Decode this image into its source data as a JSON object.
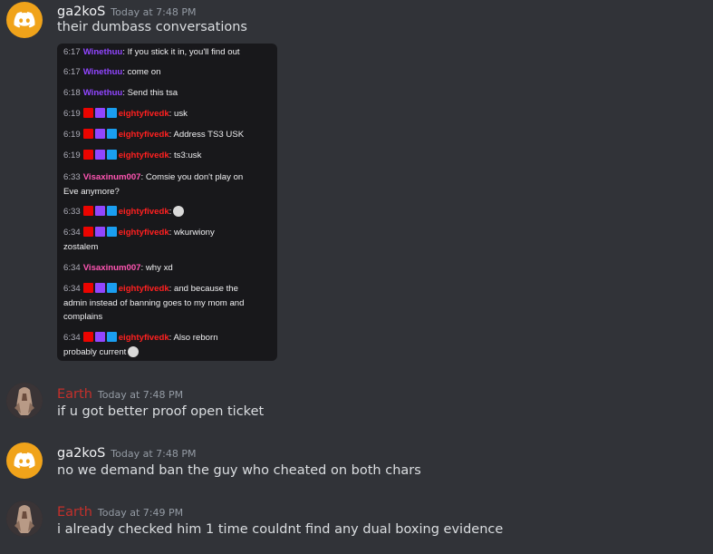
{
  "messages": [
    {
      "author": "ga2koS",
      "timestamp": "Today at 7:48 PM",
      "text": "their dumbass conversations"
    },
    {
      "author": "Earth",
      "timestamp": "Today at 7:48 PM",
      "text": "if u got better proof open ticket"
    },
    {
      "author": "ga2koS",
      "timestamp": "Today at 7:48 PM",
      "text": "no we demand ban the guy who cheated on both chars"
    },
    {
      "author": "Earth",
      "timestamp": "Today at 7:49 PM",
      "text": "i already checked him 1 time couldnt find any dual boxing evidence"
    }
  ],
  "attachment": {
    "lines": [
      {
        "time": "6:17",
        "user": "Winethuu",
        "text": ": If you stick it in, you'll find out"
      },
      {
        "time": "6:17",
        "user": "Winethuu",
        "text": ": come on"
      },
      {
        "time": "6:18",
        "user": "Winethuu",
        "text": ": Send this tsa"
      },
      {
        "time": "6:19",
        "user": "eightyfivedk",
        "text": ": usk"
      },
      {
        "time": "6:19",
        "user": "eightyfivedk",
        "text": ": Address TS3 USK"
      },
      {
        "time": "6:19",
        "user": "eightyfivedk",
        "text": ": ts3:usk"
      },
      {
        "time": "6:33",
        "user": "Visaxinum007",
        "text": ": Comsie you don't play on",
        "text2": "Eve anymore?"
      },
      {
        "time": "6:33",
        "user": "eightyfivedk",
        "text": ":"
      },
      {
        "time": "6:34",
        "user": "eightyfivedk",
        "text": ": wkurwiony",
        "text2": "zostalem"
      },
      {
        "time": "6:34",
        "user": "Visaxinum007",
        "text": ": why xd"
      },
      {
        "time": "6:34",
        "user": "eightyfivedk",
        "text": ": and because the",
        "text2": "admin instead of banning goes to my mom and",
        "text3": "complains"
      },
      {
        "time": "6:34",
        "user": "eightyfivedk",
        "text": ": Also reborn",
        "text2": "probably current"
      }
    ]
  },
  "colors": {
    "background": "#313338",
    "earth_name": "#c4302b",
    "discord_avatar": "#f0a31a",
    "user_winethuu": "#9146ff",
    "user_eightyfivedk": "#ff2020",
    "user_visaxinum": "#ff55b3"
  },
  "icons": [
    "discord-logo-icon",
    "video-badge-icon",
    "star-badge-icon",
    "crown-badge-icon",
    "emote-icon"
  ]
}
